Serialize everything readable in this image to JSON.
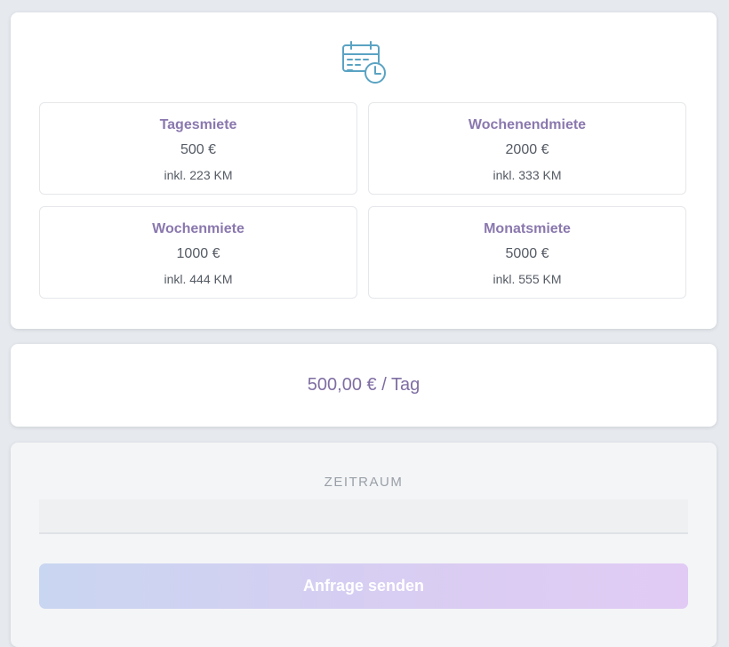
{
  "colors": {
    "accent": "#8a78ae",
    "icon": "#5aa3c3",
    "button_gradient_start": "#c9d6f1",
    "button_gradient_end": "#e1cbf4"
  },
  "header_icon": "calendar-clock-icon",
  "rates": [
    {
      "name": "Tagesmiete",
      "price": "500 €",
      "km": "inkl. 223 KM"
    },
    {
      "name": "Wochenendmiete",
      "price": "2000 €",
      "km": "inkl. 333 KM"
    },
    {
      "name": "Wochenmiete",
      "price": "1000 €",
      "km": "inkl. 444 KM"
    },
    {
      "name": "Monatsmiete",
      "price": "5000 €",
      "km": "inkl. 555 KM"
    }
  ],
  "price_summary": "500,00 € / Tag",
  "form": {
    "period_label": "ZEITRAUM",
    "period_value": "",
    "submit_label": "Anfrage senden"
  }
}
